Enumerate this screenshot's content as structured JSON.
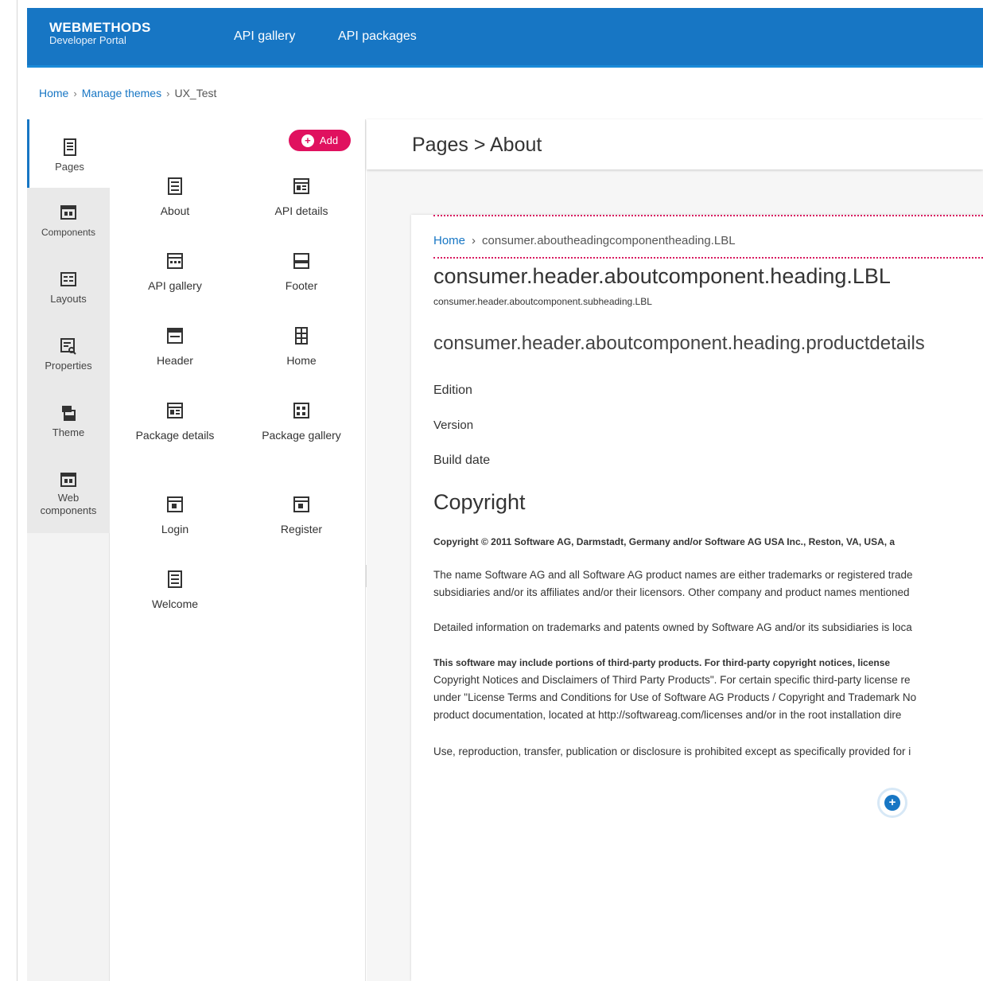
{
  "header": {
    "brand_name": "WEBMETHODS",
    "brand_sub": "Developer Portal",
    "nav": [
      "API gallery",
      "API packages"
    ]
  },
  "breadcrumb": {
    "home": "Home",
    "manage": "Manage themes",
    "current": "UX_Test"
  },
  "sidenav": {
    "items": [
      {
        "label": "Pages",
        "icon": "pages-icon",
        "active": true
      },
      {
        "label": "Components",
        "icon": "components-icon"
      },
      {
        "label": "Layouts",
        "icon": "layouts-icon"
      },
      {
        "label": "Properties",
        "icon": "properties-icon"
      },
      {
        "label": "Theme",
        "icon": "theme-icon"
      },
      {
        "label": "Web components",
        "icon": "web-components-icon"
      }
    ]
  },
  "panel": {
    "add_label": "Add",
    "tiles": [
      {
        "label": "About"
      },
      {
        "label": "API details"
      },
      {
        "label": "API gallery"
      },
      {
        "label": "Footer"
      },
      {
        "label": "Header"
      },
      {
        "label": "Home"
      },
      {
        "label": "Package details"
      },
      {
        "label": "Package gallery"
      },
      {
        "label": "Login"
      },
      {
        "label": "Register"
      },
      {
        "label": "Welcome"
      }
    ]
  },
  "main": {
    "title": "Pages > About",
    "content": {
      "bc_home": "Home",
      "bc_current": "consumer.aboutheadingcomponentheading.LBL",
      "heading": "consumer.header.aboutcomponent.heading.LBL",
      "subheading": "consumer.header.aboutcomponent.subheading.LBL",
      "product_heading": "consumer.header.aboutcomponent.heading.productdetails",
      "fields": [
        "Edition",
        "Version",
        "Build date"
      ],
      "copyright_heading": "Copyright",
      "paragraphs": [
        "Copyright © 2011 Software AG, Darmstadt, Germany and/or Software AG USA Inc., Reston, VA, USA, a",
        "The name Software AG and all Software AG product names are either trademarks or registered trade",
        "subsidiaries and/or its affiliates and/or their licensors. Other company and product names mentioned",
        "Detailed information on trademarks and patents owned by Software AG and/or its subsidiaries is loca",
        "This software may include portions of third-party products. For third-party copyright notices, license",
        "Copyright Notices and Disclaimers of Third Party Products\". For certain specific third-party license re",
        "under \"License Terms and Conditions for Use of Software AG Products / Copyright and Trademark No",
        "product documentation, located at http://softwareag.com/licenses and/or in the root installation dire",
        "Use, reproduction, transfer, publication or disclosure is prohibited except as specifically provided for i"
      ]
    }
  },
  "colors": {
    "brand_blue": "#1776c4",
    "accent_pink": "#e0115f"
  }
}
